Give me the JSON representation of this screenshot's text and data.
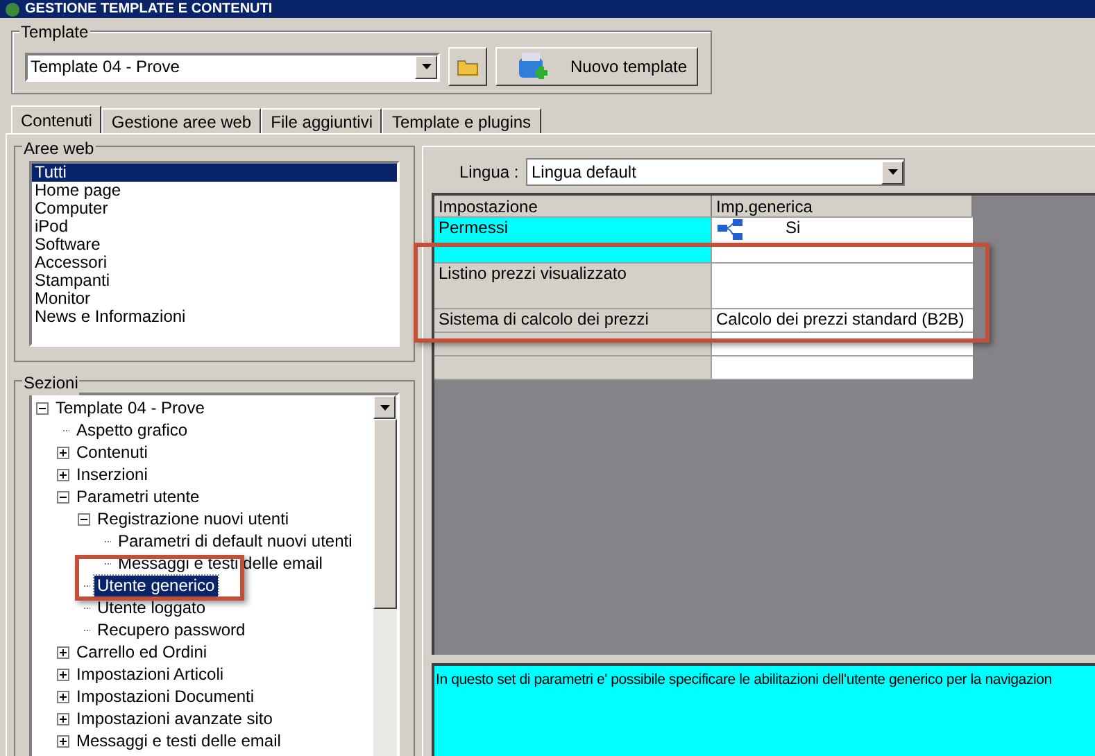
{
  "window": {
    "title": "GESTIONE TEMPLATE E CONTENUTI"
  },
  "template": {
    "label": "Template",
    "value": "Template 04 - Prove",
    "new_button": "Nuovo template"
  },
  "tabs": [
    {
      "label": "Contenuti",
      "selected": true
    },
    {
      "label": "Gestione aree web",
      "selected": false
    },
    {
      "label": "File aggiuntivi",
      "selected": false
    },
    {
      "label": "Template e plugins",
      "selected": false
    }
  ],
  "aree_web": {
    "label": "Aree web",
    "items": [
      {
        "label": "Tutti",
        "selected": true
      },
      {
        "label": "Home page",
        "selected": false
      },
      {
        "label": "Computer",
        "selected": false
      },
      {
        "label": "iPod",
        "selected": false
      },
      {
        "label": "Software",
        "selected": false
      },
      {
        "label": "Accessori",
        "selected": false
      },
      {
        "label": "Stampanti",
        "selected": false
      },
      {
        "label": "Monitor",
        "selected": false
      },
      {
        "label": "News e Informazioni",
        "selected": false
      }
    ]
  },
  "sezioni": {
    "label": "Sezioni",
    "tree": [
      {
        "label": "Template 04 - Prove",
        "selected": false,
        "expanded": true,
        "children": [
          {
            "label": "Aspetto grafico",
            "selected": false
          },
          {
            "label": "Contenuti",
            "selected": false,
            "expanded": false
          },
          {
            "label": "Inserzioni",
            "selected": false,
            "expanded": false
          },
          {
            "label": "Parametri utente",
            "selected": false,
            "expanded": true,
            "children": [
              {
                "label": "Registrazione nuovi utenti",
                "selected": false,
                "expanded": true,
                "children": [
                  {
                    "label": "Parametri di default nuovi utenti",
                    "selected": false
                  },
                  {
                    "label": "Messaggi e testi delle email",
                    "selected": false
                  }
                ]
              },
              {
                "label": "Utente generico",
                "selected": true
              },
              {
                "label": "Utente loggato",
                "selected": false
              },
              {
                "label": "Recupero password",
                "selected": false
              }
            ]
          },
          {
            "label": "Carrello ed Ordini",
            "selected": false,
            "expanded": false
          },
          {
            "label": "Impostazioni Articoli",
            "selected": false,
            "expanded": false
          },
          {
            "label": "Impostazioni Documenti",
            "selected": false,
            "expanded": false
          },
          {
            "label": "Impostazioni avanzate sito",
            "selected": false,
            "expanded": false
          },
          {
            "label": "Messaggi e testi delle email",
            "selected": false,
            "expanded": false
          }
        ]
      }
    ]
  },
  "lingua": {
    "label": "Lingua :",
    "value": "Lingua default"
  },
  "table": {
    "columns": [
      "Impostazione",
      "Imp.generica"
    ],
    "rows": [
      {
        "setting": "Permessi",
        "value": "Si",
        "kind": "hierarchy",
        "selected": true,
        "tall": true
      },
      {
        "setting": "Listino prezzi visualizzato",
        "value": "",
        "kind": "text",
        "selected": false,
        "tall": true
      },
      {
        "setting": "Sistema di calcolo dei prezzi",
        "value": "Calcolo dei prezzi standard (B2B)",
        "kind": "text",
        "selected": false,
        "tall": false
      },
      {
        "setting": "",
        "value": "",
        "kind": "text",
        "selected": false,
        "tall": false
      },
      {
        "setting": "",
        "value": "",
        "kind": "text",
        "selected": false,
        "tall": false
      }
    ]
  },
  "description": "In questo set di parametri e' possibile specificare le abilitazioni dell'utente generico per la navigazion"
}
